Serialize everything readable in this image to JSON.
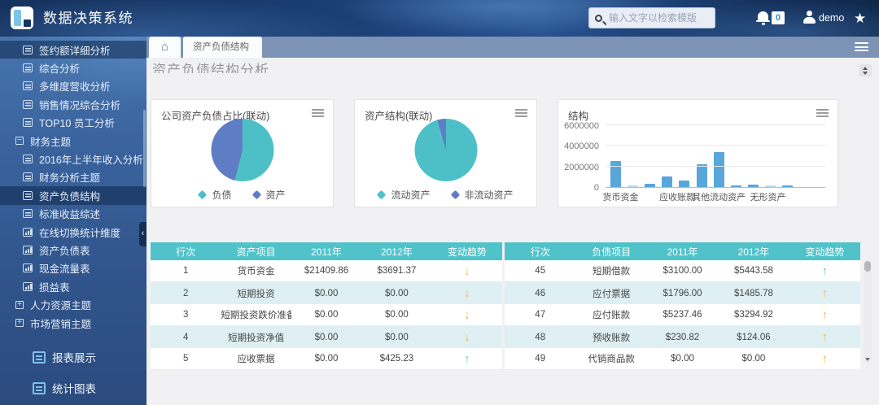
{
  "app": {
    "title": "数据决策系统"
  },
  "topbar": {
    "search_placeholder": "输入文字以检索模版",
    "notification_count": "0",
    "username": "demo"
  },
  "sidebar": {
    "items": [
      {
        "label": "签约额详细分析",
        "icon": "report",
        "selected": true
      },
      {
        "label": "综合分析",
        "icon": "report"
      },
      {
        "label": "多维度营收分析",
        "icon": "report"
      },
      {
        "label": "销售情况综合分析",
        "icon": "report"
      },
      {
        "label": "TOP10 员工分析",
        "icon": "report"
      },
      {
        "label": "财务主题",
        "icon": "minus",
        "group": true
      },
      {
        "label": "2016年上半年收入分析",
        "icon": "report"
      },
      {
        "label": "财务分析主题",
        "icon": "report"
      },
      {
        "label": "资产负债结构",
        "icon": "report",
        "selected": true
      },
      {
        "label": "标准收益综述",
        "icon": "report"
      },
      {
        "label": "在线切换统计维度",
        "icon": "chart"
      },
      {
        "label": "资产负债表",
        "icon": "chart"
      },
      {
        "label": "现金流量表",
        "icon": "chart"
      },
      {
        "label": "损益表",
        "icon": "chart"
      },
      {
        "label": "人力资源主题",
        "icon": "plus",
        "group": true
      },
      {
        "label": "市场营销主题",
        "icon": "plus",
        "group": true
      }
    ],
    "bottom_items": [
      {
        "label": "报表展示"
      },
      {
        "label": "统计图表"
      }
    ],
    "collapse_glyph": "‹"
  },
  "tabbar": {
    "active_tab": "资产负债结构",
    "home_glyph": "⌂"
  },
  "page": {
    "title": "资产负债结构分析"
  },
  "chart_data": [
    {
      "id": "pie_company_asset_liability",
      "type": "pie",
      "title": "公司资产负债占比(联动)",
      "series": [
        {
          "name": "负债",
          "value_pct": 54,
          "color": "#4dc0c7"
        },
        {
          "name": "资产",
          "value_pct": 46,
          "color": "#5f7dc5"
        }
      ],
      "legend_position": "bottom"
    },
    {
      "id": "pie_asset_structure",
      "type": "pie",
      "title": "资产结构(联动)",
      "series": [
        {
          "name": "流动资产",
          "value_pct": 95.5,
          "color": "#4dc0c7"
        },
        {
          "name": "非流动资产",
          "value_pct": 4.5,
          "color": "#5f7dc5"
        }
      ],
      "legend_position": "bottom"
    },
    {
      "id": "bar_structure",
      "type": "bar",
      "title": "结构",
      "values": [
        2560000,
        100000,
        300000,
        1050000,
        650000,
        2250000,
        3400000,
        150000,
        200000,
        80000,
        150000
      ],
      "x_labels": [
        "货币资金",
        "应收账款",
        "其他流动资产",
        "无形资产"
      ],
      "x_label_positions_pct": [
        8,
        38,
        60,
        86
      ],
      "y_ticks": [
        6000000,
        4000000,
        2000000,
        0
      ],
      "ylim": [
        0,
        6000000
      ],
      "grid": true,
      "bar_color": "#58a6da",
      "light_bar_color": "#b9dcf2",
      "light_bar_indices": [
        1,
        9
      ]
    }
  ],
  "tables": {
    "assets": {
      "headers": [
        "行次",
        "资产项目",
        "2011年",
        "2012年",
        "变动趋势"
      ],
      "rows": [
        {
          "row_no": "1",
          "item": "货币资金",
          "y2011": "$21409.86",
          "y2012": "$3691.37",
          "trend": "down_orange"
        },
        {
          "row_no": "2",
          "item": "短期投资",
          "y2011": "$0.00",
          "y2012": "$0.00",
          "trend": "down_orange"
        },
        {
          "row_no": "3",
          "item": "短期投资跌价准备",
          "y2011": "$0.00",
          "y2012": "$0.00",
          "trend": "down_orange"
        },
        {
          "row_no": "4",
          "item": "短期投资净值",
          "y2011": "$0.00",
          "y2012": "$0.00",
          "trend": "down_orange"
        },
        {
          "row_no": "5",
          "item": "应收票据",
          "y2011": "$0.00",
          "y2012": "$425.23",
          "trend": "up_teal"
        }
      ]
    },
    "liabilities": {
      "headers": [
        "行次",
        "负债项目",
        "2011年",
        "2012年",
        "变动趋势"
      ],
      "rows": [
        {
          "row_no": "45",
          "item": "短期借款",
          "y2011": "$3100.00",
          "y2012": "$5443.58",
          "trend": "up_teal"
        },
        {
          "row_no": "46",
          "item": "应付票据",
          "y2011": "$1796.00",
          "y2012": "$1485.78",
          "trend": "up_orange"
        },
        {
          "row_no": "47",
          "item": "应付账款",
          "y2011": "$5237.46",
          "y2012": "$3294.92",
          "trend": "up_orange"
        },
        {
          "row_no": "48",
          "item": "预收账款",
          "y2011": "$230.82",
          "y2012": "$124.06",
          "trend": "up_orange"
        },
        {
          "row_no": "49",
          "item": "代销商品款",
          "y2011": "$0.00",
          "y2012": "$0.00",
          "trend": "up_orange"
        }
      ]
    }
  },
  "colors": {
    "teal": "#4dc0c7",
    "pie_blue": "#5f7dc5",
    "bar_blue": "#58a6da",
    "bar_light_blue": "#b9dcf2",
    "table_header": "#4fc3c9",
    "table_alt_row": "#def0f4",
    "arrow_up_teal": "#5fd0a8",
    "arrow_orange": "#f7b83e"
  }
}
